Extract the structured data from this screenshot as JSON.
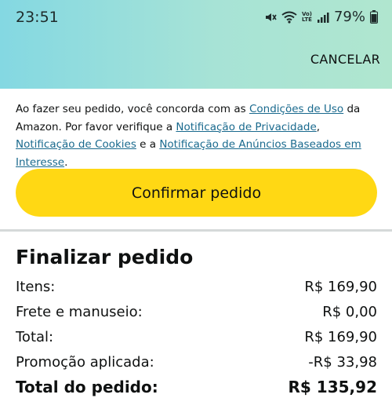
{
  "status_bar": {
    "time": "23:51",
    "volte_line1": "Vo)",
    "volte_line2": "LTE",
    "battery_percent": "79%",
    "icons": [
      "mute-icon",
      "wifi-icon",
      "volte-icon",
      "signal-icon",
      "battery-icon"
    ]
  },
  "header": {
    "cancel_label": "CANCELAR"
  },
  "agreement": {
    "prefix": "Ao fazer seu pedido, você concorda com as ",
    "terms_link": "Condições de Uso",
    "mid1": " da Amazon. Por favor verifique a ",
    "privacy_link": "Notificação de Privacidade",
    "sep": ", ",
    "cookies_link": "Notificação de Cookies",
    "mid2": " e a ",
    "ads_link": "Notificação de Anúncios Baseados em Interesse",
    "suffix": "."
  },
  "confirm_button": {
    "label": "Confirmar pedido"
  },
  "summary": {
    "title": "Finalizar pedido",
    "rows": [
      {
        "label": "Itens:",
        "value": "R$ 169,90"
      },
      {
        "label": "Frete e manuseio:",
        "value": "R$ 0,00"
      },
      {
        "label": "Total:",
        "value": "R$ 169,90"
      },
      {
        "label": "Promoção aplicada:",
        "value": "-R$ 33,98"
      }
    ],
    "order_total": {
      "label": "Total do pedido:",
      "value": "R$ 135,92"
    }
  },
  "colors": {
    "header_gradient_start": "#84d8e2",
    "header_gradient_end": "#b0e6cf",
    "confirm_button": "#ffd814",
    "link": "#1a6a8e",
    "divider": "#d5d9d9"
  }
}
